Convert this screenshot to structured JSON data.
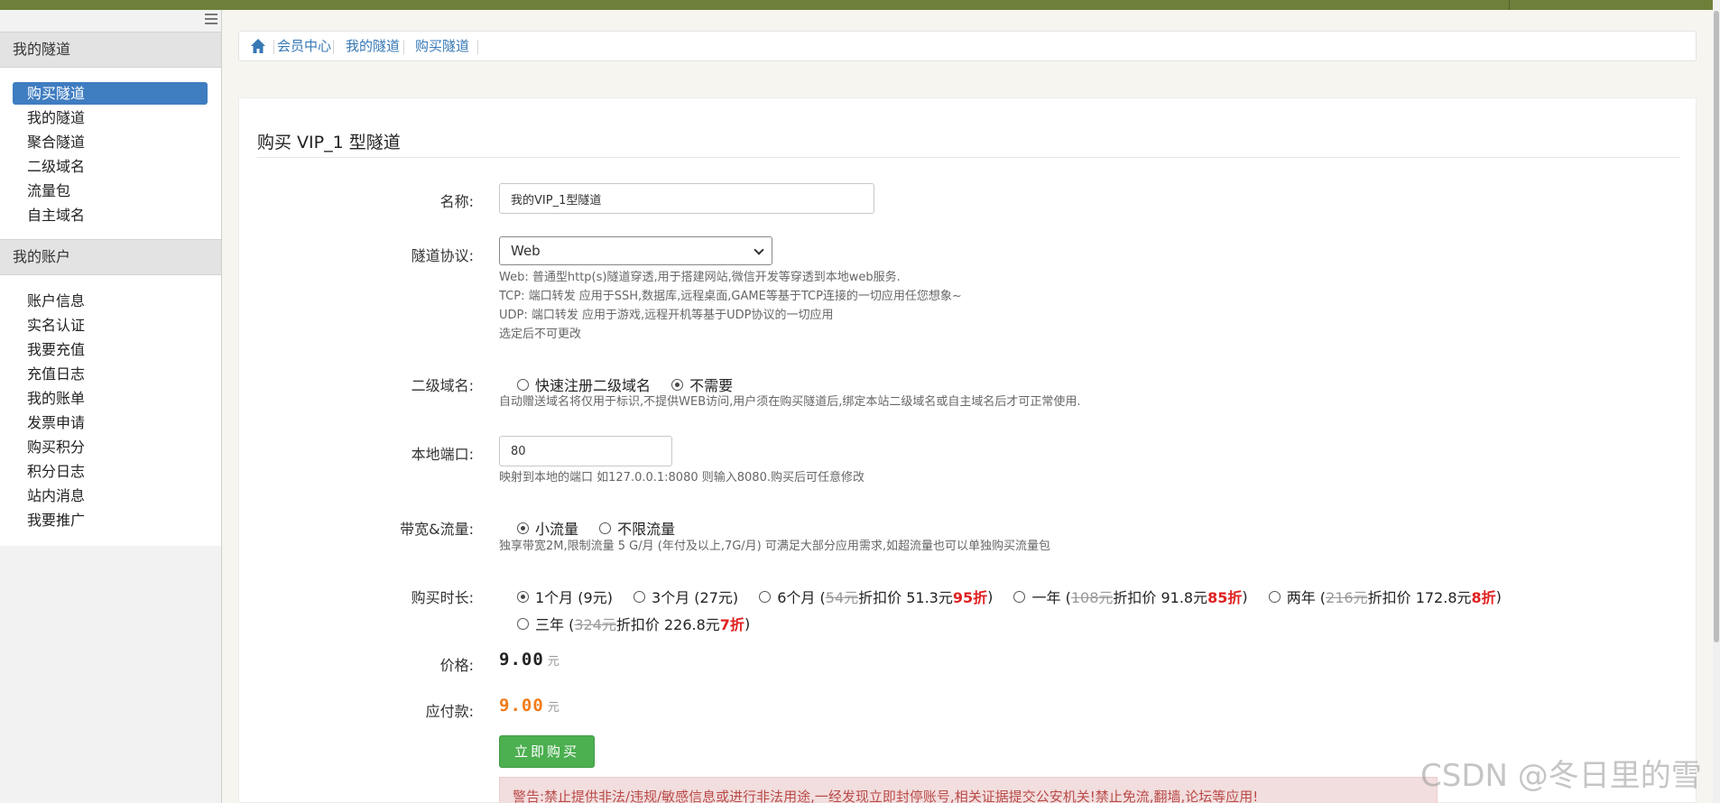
{
  "sidebar": {
    "group1_title": "我的隧道",
    "group1_items": [
      "购买隧道",
      "我的隧道",
      "聚合隧道",
      "二级域名",
      "流量包",
      "自主域名"
    ],
    "group2_title": "我的账户",
    "group2_items": [
      "账户信息",
      "实名认证",
      "我要充值",
      "充值日志",
      "我的账单",
      "发票申请",
      "购买积分",
      "积分日志",
      "站内消息",
      "我要推广"
    ]
  },
  "breadcrumb": [
    "会员中心",
    "我的隧道",
    "购买隧道"
  ],
  "form": {
    "title": "购买 VIP_1 型隧道",
    "name_label": "名称:",
    "name_value": "我的VIP_1型隧道",
    "protocol_label": "隧道协议:",
    "protocol_value": "Web",
    "protocol_help": [
      "Web: 普通型http(s)隧道穿透,用于搭建网站,微信开发等穿透到本地web服务.",
      "TCP: 端口转发 应用于SSH,数据库,远程桌面,GAME等基于TCP连接的一切应用任您想象~",
      "UDP: 端口转发 应用于游戏,远程开机等基于UDP协议的一切应用",
      "选定后不可更改"
    ],
    "subdomain_label": "二级域名:",
    "subdomain_opt1": "快速注册二级域名",
    "subdomain_opt2": "不需要",
    "subdomain_help": "自动赠送域名将仅用于标识,不提供WEB访问,用户须在购买隧道后,绑定本站二级域名或自主域名后才可正常使用.",
    "port_label": "本地端口:",
    "port_value": "80",
    "port_help": "映射到本地的端口 如127.0.0.1:8080 则输入8080.购买后可任意修改",
    "bw_label": "带宽&流量:",
    "bw_opt1": "小流量",
    "bw_opt2": "不限流量",
    "bw_help": "独享带宽2M,限制流量 5 G/月 (年付及以上,7G/月) 可满足大部分应用需求,如超流量也可以单独购买流量包",
    "duration_label": "购买时长:",
    "durations": {
      "d1": "1个月 (9元)",
      "d3": "3个月 (27元)",
      "d6_pre": "6个月 (",
      "d6_orig": "54元",
      "d6_mid": " 折扣价 51.3元 ",
      "d6_disc": "95折",
      "y1_pre": "一年 (",
      "y1_orig": "108元",
      "y1_mid": " 折扣价 91.8元 ",
      "y1_disc": "85折",
      "y2_pre": "两年 (",
      "y2_orig": "216元",
      "y2_mid": " 折扣价 172.8元 ",
      "y2_disc": "8折",
      "y3_pre": "三年 (",
      "y3_orig": "324元",
      "y3_mid": " 折扣价 226.8元 ",
      "y3_disc": "7折",
      "close": ")"
    },
    "price_label": "价格:",
    "price_value": "9.00",
    "payable_label": "应付款:",
    "payable_value": "9.00",
    "unit": "元",
    "buy_label": "立即购买",
    "warning": "警告:禁止提供非法/违规/敏感信息或进行非法用途,一经发现立即封停账号,相关证据提交公安机关!禁止免流,翻墙,论坛等应用!"
  },
  "watermark": "CSDN @冬日里的雪",
  "colors": {
    "accent": "#3f7dc1",
    "topbar": "#6e7f3a",
    "buy": "#4caf50",
    "payable": "#f07c1a",
    "discount": "#e02121"
  }
}
